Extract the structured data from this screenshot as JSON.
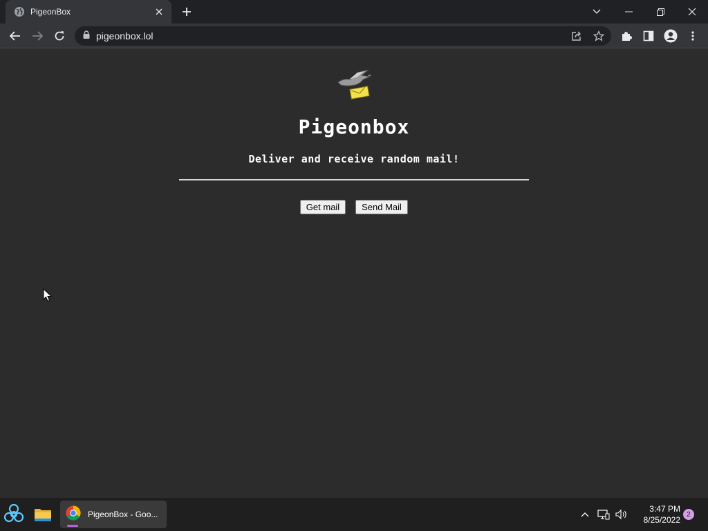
{
  "browser": {
    "tab": {
      "title": "PigeonBox",
      "favicon": "globe-icon"
    },
    "address_bar": {
      "url": "pigeonbox.lol"
    }
  },
  "page": {
    "title": "Pigeonbox",
    "tagline": "Deliver and receive random mail!",
    "buttons": {
      "get_mail": "Get mail",
      "send_mail": "Send Mail"
    }
  },
  "taskbar": {
    "chrome_window_label": "PigeonBox - Goo...",
    "clock": {
      "time": "3:47 PM",
      "date": "8/25/2022"
    },
    "notification_count": "2"
  },
  "colors": {
    "page_background": "#2c2c2c",
    "chrome_frame": "#202124",
    "chrome_toolbar": "#35363a",
    "taskbar": "#1f1f1f",
    "accent": "#b565d8"
  }
}
